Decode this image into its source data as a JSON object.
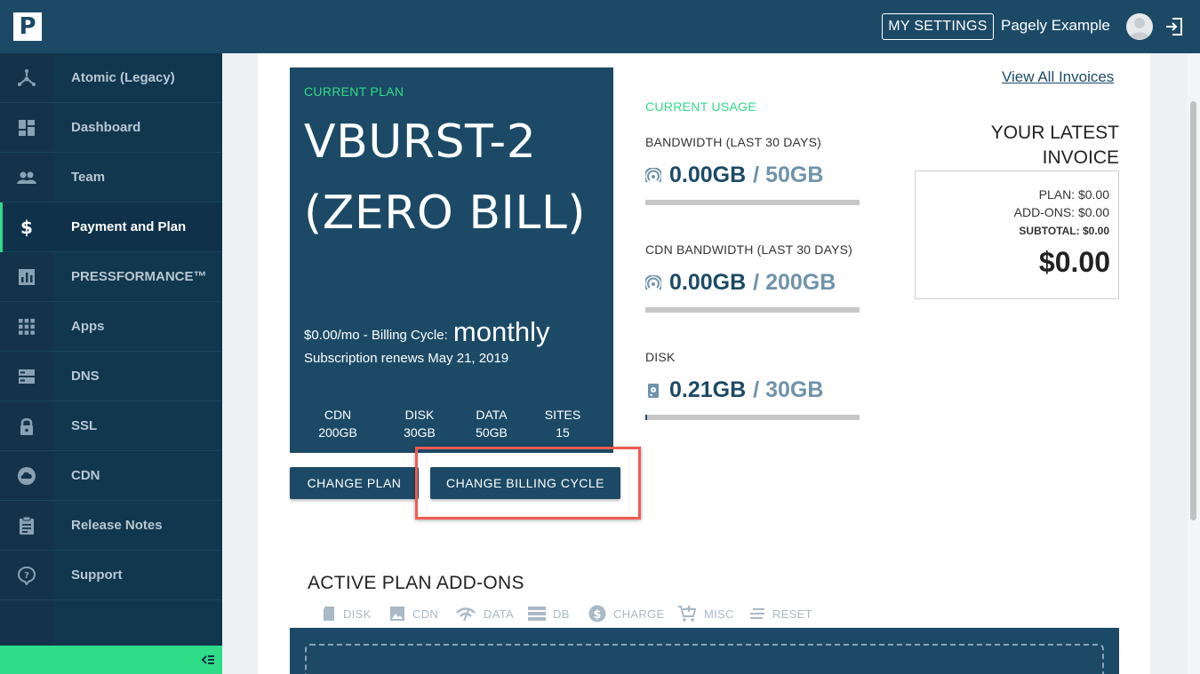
{
  "header": {
    "logo_letter": "P",
    "settings_label": "MY SETTINGS",
    "username": "Pagely Example"
  },
  "sidebar": {
    "items": [
      {
        "label": "Atomic (Legacy)",
        "icon": "atomic-icon"
      },
      {
        "label": "Dashboard",
        "icon": "dashboard-icon"
      },
      {
        "label": "Team",
        "icon": "team-icon"
      },
      {
        "label": "Payment and Plan",
        "icon": "dollar-icon",
        "active": true
      },
      {
        "label": "PRESSFORMANCE™",
        "icon": "chart-icon"
      },
      {
        "label": "Apps",
        "icon": "apps-grid-icon"
      },
      {
        "label": "DNS",
        "icon": "dns-icon"
      },
      {
        "label": "SSL",
        "icon": "lock-icon"
      },
      {
        "label": "CDN",
        "icon": "cloud-icon"
      },
      {
        "label": "Release Notes",
        "icon": "clipboard-icon"
      },
      {
        "label": "Support",
        "icon": "help-icon"
      }
    ]
  },
  "plan": {
    "kicker": "CURRENT PLAN",
    "name": "VBURST-2 (ZERO BILL)",
    "price": "$0.00/mo - Billing Cycle:",
    "cycle": "monthly",
    "renews": "Subscription renews May 21, 2019",
    "stats": [
      {
        "label": "CDN",
        "value": "200GB"
      },
      {
        "label": "DISK",
        "value": "30GB"
      },
      {
        "label": "DATA",
        "value": "50GB"
      },
      {
        "label": "SITES",
        "value": "15"
      }
    ],
    "change_plan_label": "CHANGE PLAN",
    "change_cycle_label": "CHANGE BILLING CYCLE"
  },
  "usage": {
    "kicker": "CURRENT USAGE",
    "items": [
      {
        "label": "BANDWIDTH (LAST 30 DAYS)",
        "used": "0.00GB",
        "limit": "/ 50GB",
        "fraction": 0.0
      },
      {
        "label": "CDN BANDWIDTH (LAST 30 DAYS)",
        "used": "0.00GB",
        "limit": "/ 200GB",
        "fraction": 0.0
      },
      {
        "label": "DISK",
        "used": "0.21GB",
        "limit": "/ 30GB",
        "fraction": 0.007
      }
    ]
  },
  "invoice": {
    "link": "View All Invoices",
    "title": "YOUR LATEST INVOICE",
    "plan": "PLAN: $0.00",
    "addons": "ADD-ONS: $0.00",
    "subtotal": "SUBTOTAL: $0.00",
    "total": "$0.00"
  },
  "addons": {
    "title": "ACTIVE PLAN ADD-ONS",
    "tabs": [
      "DISK",
      "CDN",
      "DATA",
      "DB",
      "CHARGE",
      "MISC",
      "RESET"
    ]
  },
  "colors": {
    "brand": "#1c4a66",
    "accent": "#2fdc87",
    "highlight": "#ef5a50"
  }
}
